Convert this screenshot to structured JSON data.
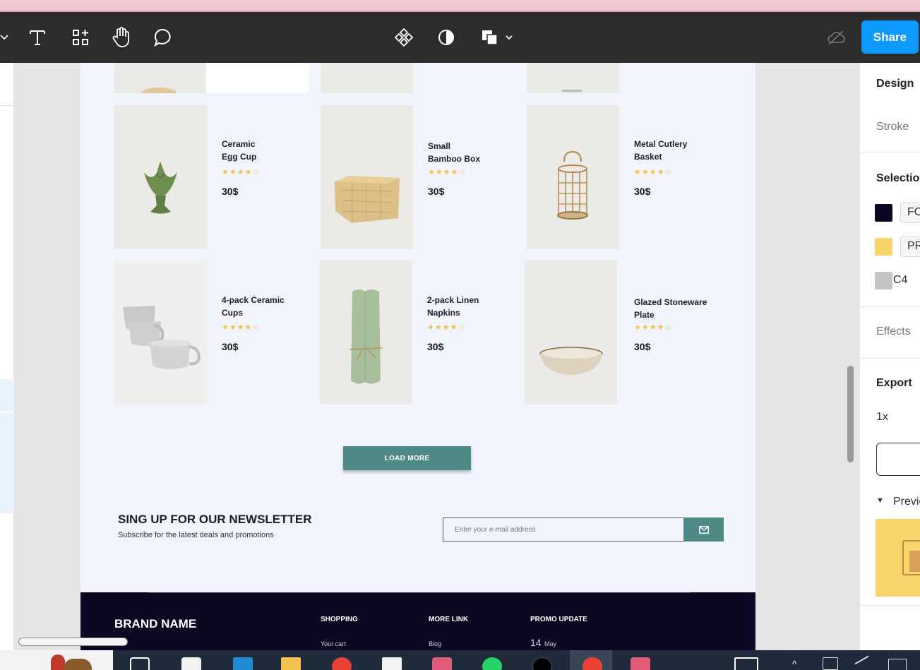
{
  "toolbar": {
    "share_label": "Share",
    "icons": [
      "chevron-down-icon",
      "text-tool-icon",
      "frame-tool-icon",
      "hand-tool-icon",
      "comment-icon",
      "components-icon",
      "contrast-icon",
      "layers-icon",
      "cloud-off-icon"
    ]
  },
  "products": [
    {
      "name_line1": "Ceramic",
      "name_line2": "Egg Cup",
      "stars": "★★★★☆",
      "price": "30$"
    },
    {
      "name_line1": "Small",
      "name_line2": "Bamboo Box",
      "stars": "★★★★☆",
      "price": "30$"
    },
    {
      "name_line1": "Metal Cutlery",
      "name_line2": "Basket",
      "stars": "★★★★☆",
      "price": "30$"
    },
    {
      "name_line1": "4-pack Ceramic",
      "name_line2": "Cups",
      "stars": "★★★★☆",
      "price": "30$"
    },
    {
      "name_line1": "2-pack Linen",
      "name_line2": "Napkins",
      "stars": "★★★★☆",
      "price": "30$"
    },
    {
      "name_line1": "Glazed Stoneware",
      "name_line2": "Plate",
      "stars": "★★★★☆",
      "price": "30$"
    }
  ],
  "load_more_label": "LOAD MORE",
  "newsletter": {
    "title": "SING UP FOR OUR NEWSLETTER",
    "subtitle": "Subscribe for the latest deals and promotions",
    "placeholder": "Enter your e-mail address"
  },
  "footer": {
    "brand": "BRAND NAME",
    "col1_title": "SHOPPING",
    "col1_link": "Your cart",
    "col2_title": "MORE LINK",
    "col2_link": "Blog",
    "col3_title": "PROMO UPDATE",
    "col3_day": "14",
    "col3_month": "May"
  },
  "right_panel": {
    "design_tab": "Design",
    "stroke_label": "Stroke",
    "selection_label": "Selection",
    "color1_hex": "FO",
    "color2_hex": "PR",
    "color3_hex": "C4",
    "effects_label": "Effects",
    "export_label": "Export",
    "export_scale": "1x",
    "preview_label": "Preview",
    "color1": "#0c0824",
    "color2": "#f7d56b",
    "color3": "#c4c4c4"
  },
  "colors": {
    "accent_teal": "#4f8a87",
    "share_blue": "#0d99ff",
    "footer_navy": "#0c0824"
  }
}
